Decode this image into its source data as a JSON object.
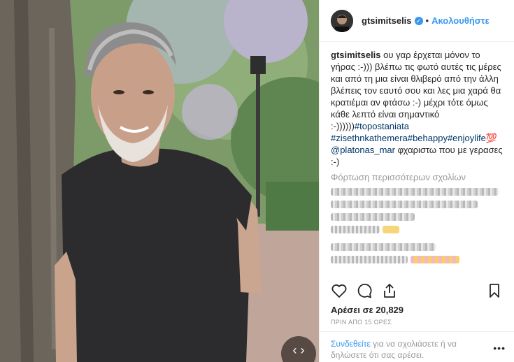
{
  "post": {
    "username": "gtsimitselis",
    "follow_label": "Ακολουθήστε",
    "verified_symbol": "✓",
    "separator": "•"
  },
  "caption": {
    "username": "gtsimitselis",
    "text": " ου γαρ έρχεται μόνον το γήρας :-))) βλέπω τις φωτό αυτές τις μέρες και από τη μια είναι θλιβερό από την άλλη βλέπεις τον εαυτό σου και λες μια χαρά θα κρατιέμαι αν φτάσω :-) μέχρι τότε όμως κάθε λεπτό είναι σημαντικό :-))))))",
    "hashtags_line1": "#topostaniata",
    "hashtags_line2": "#zisethnkathemera#behappy#enjoylife💯",
    "mention": "@platonas_mar",
    "after_mention": " φχαριστω που με γερασες :-)"
  },
  "load_more_label": "Φόρτωση περισσότερων σχολίων",
  "likes_label": "Αρέσει σε 20,829",
  "time_label": "ΠΡΙΝ ΑΠΟ 15 ΩΡΕΣ",
  "login_prompt": {
    "link": "Συνδεθείτε",
    "rest": " για να σχολιάσετε ή να δηλώσετε ότι σας αρέσει."
  },
  "more_options": "•••",
  "nav_arrows": "‹ ›",
  "colors": {
    "accent": "#3897f0",
    "hashtag": "#003569",
    "muted": "#999999",
    "text": "#262626"
  },
  "icons": [
    "heart-icon",
    "comment-icon",
    "share-icon",
    "bookmark-icon",
    "verified-icon"
  ]
}
